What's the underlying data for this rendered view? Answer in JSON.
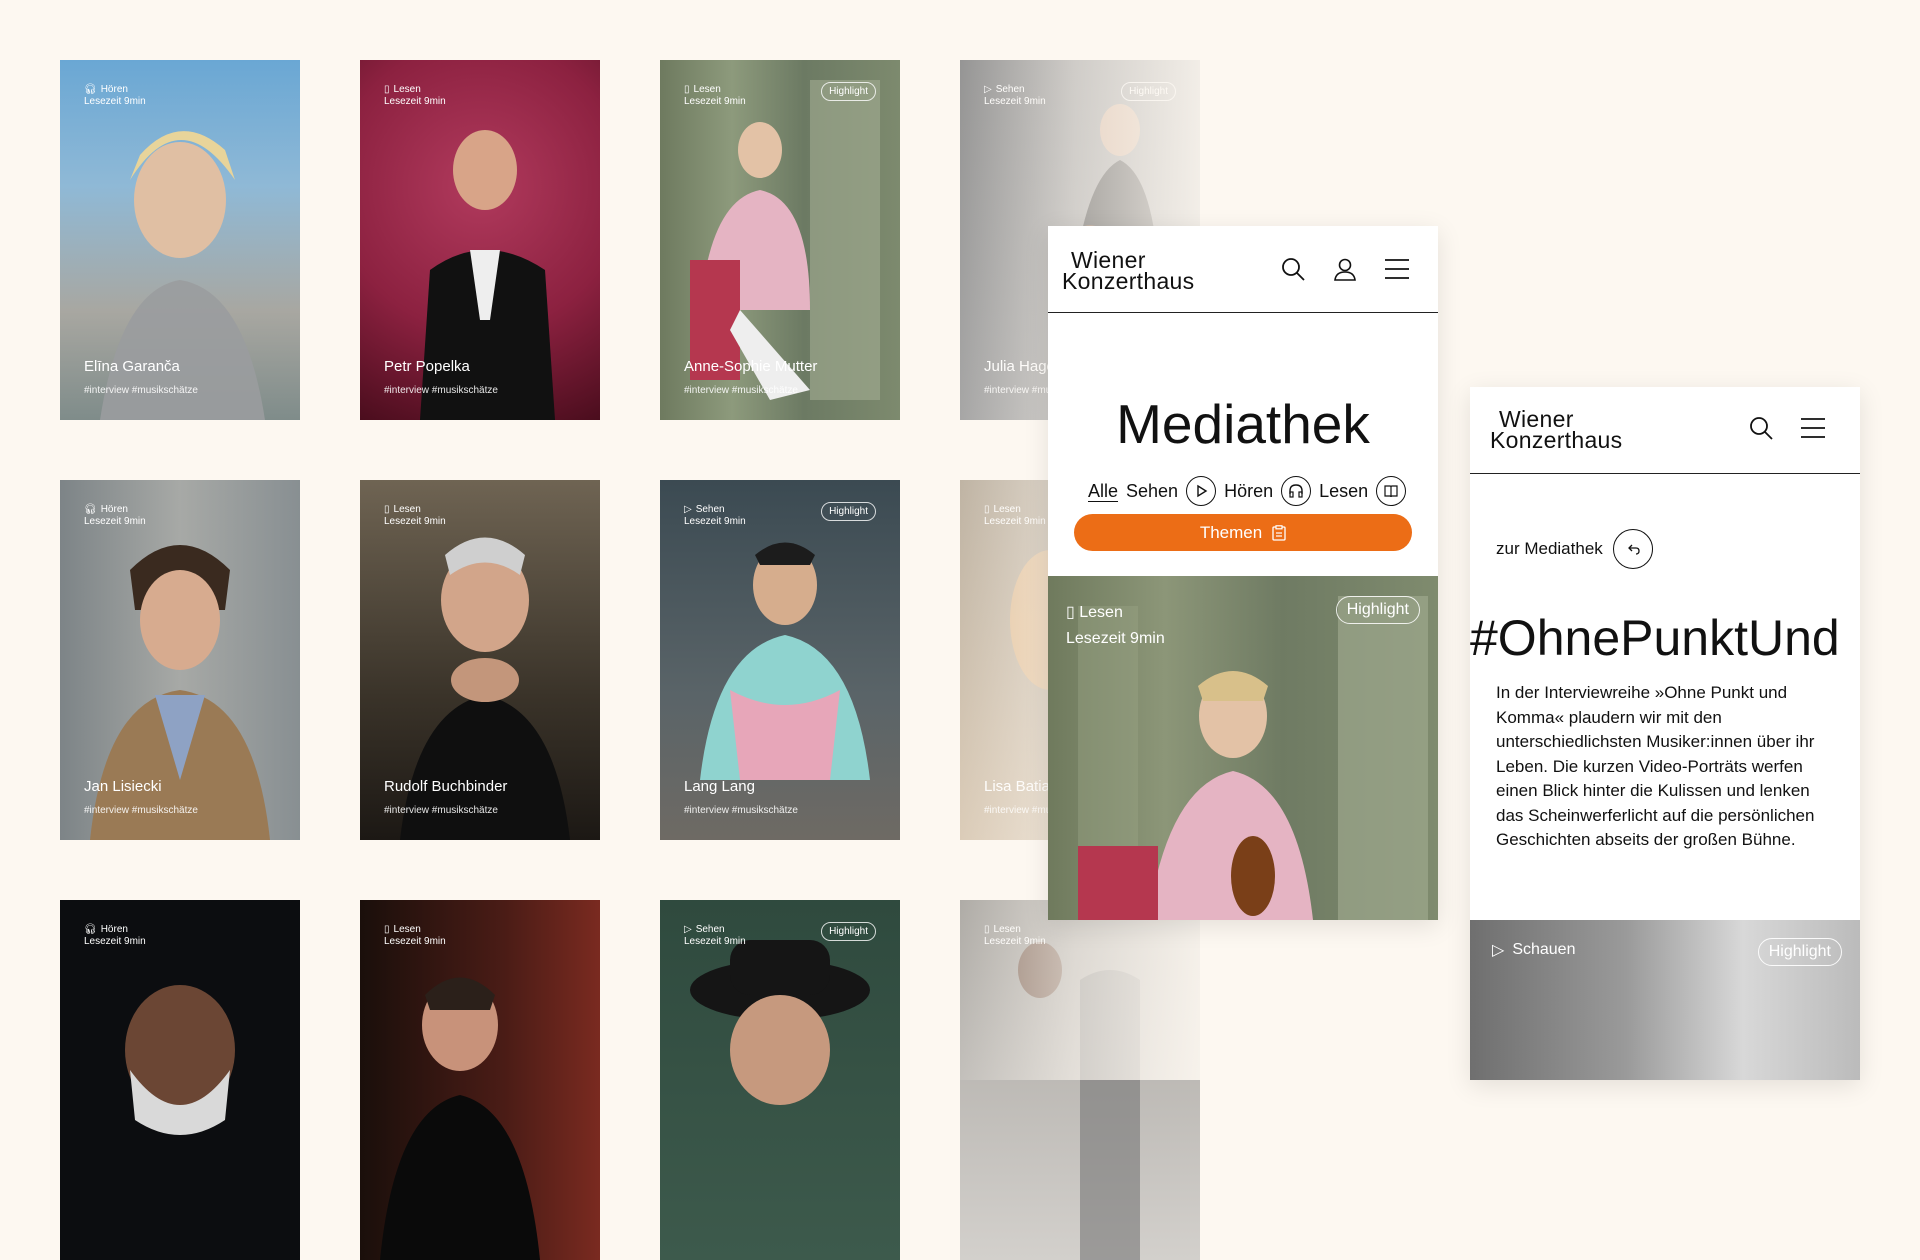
{
  "cards": [
    {
      "type": "Hören",
      "read": "Lesezeit 9min",
      "name": "Elīna Garanča",
      "tags": "#interview #musikschätze",
      "badge": ""
    },
    {
      "type": "Lesen",
      "read": "Lesezeit 9min",
      "name": "Petr Popelka",
      "tags": "#interview #musikschätze",
      "badge": ""
    },
    {
      "type": "Lesen",
      "read": "Lesezeit 9min",
      "name": "Anne-Sophie Mutter",
      "tags": "#interview #musikschätze",
      "badge": "Highlight"
    },
    {
      "type": "Sehen",
      "read": "Lesezeit 9min",
      "name": "Julia Hagen & Clemens",
      "tags": "#interview #musikschätze",
      "badge": "Highlight"
    },
    {
      "type": "Hören",
      "read": "Lesezeit 9min",
      "name": "Jan Lisiecki",
      "tags": "#interview #musikschätze",
      "badge": ""
    },
    {
      "type": "Lesen",
      "read": "Lesezeit 9min",
      "name": "Rudolf Buchbinder",
      "tags": "#interview #musikschätze",
      "badge": ""
    },
    {
      "type": "Sehen",
      "read": "Lesezeit 9min",
      "name": "Lang Lang",
      "tags": "#interview #musikschätze",
      "badge": "Highlight"
    },
    {
      "type": "Lesen",
      "read": "Lesezeit 9min",
      "name": "Lisa Batiashvili",
      "tags": "#interview #musikschätze",
      "badge": ""
    },
    {
      "type": "Hören",
      "read": "Lesezeit 9min",
      "name": "",
      "tags": "",
      "badge": ""
    },
    {
      "type": "Lesen",
      "read": "Lesezeit 9min",
      "name": "",
      "tags": "",
      "badge": ""
    },
    {
      "type": "Sehen",
      "read": "Lesezeit 9min",
      "name": "",
      "tags": "",
      "badge": "Highlight"
    },
    {
      "type": "Lesen",
      "read": "Lesezeit 9min",
      "name": "",
      "tags": "",
      "badge": ""
    }
  ],
  "phone1": {
    "logo_line1": "Wiener",
    "logo_line2": "Konzerthaus",
    "title": "Mediathek",
    "filters": {
      "all": "Alle",
      "see": "Sehen",
      "hear": "Hören",
      "read": "Lesen"
    },
    "themen": "Themen",
    "feature": {
      "type": "Lesen",
      "read": "Lesezeit 9min",
      "badge": "Highlight"
    }
  },
  "phone2": {
    "logo_line1": "Wiener",
    "logo_line2": "Konzerthaus",
    "back": "zur Mediathek",
    "hashtag": "#OhnePunktUnd",
    "intro": "In der Interviewreihe »Ohne Punkt und Komma« plaudern wir mit den unterschiedlichsten Musiker:innen über ihr Leben. Die kurzen Video-Porträts werfen einen Blick hinter die Kulissen und lenken das Scheinwerferlicht auf die persönlichen Geschichten abseits der großen Bühne.",
    "media": {
      "type": "Schauen",
      "badge": "Highlight"
    }
  },
  "colors": {
    "accent": "#ec6d16",
    "background": "#fdf8f1"
  }
}
